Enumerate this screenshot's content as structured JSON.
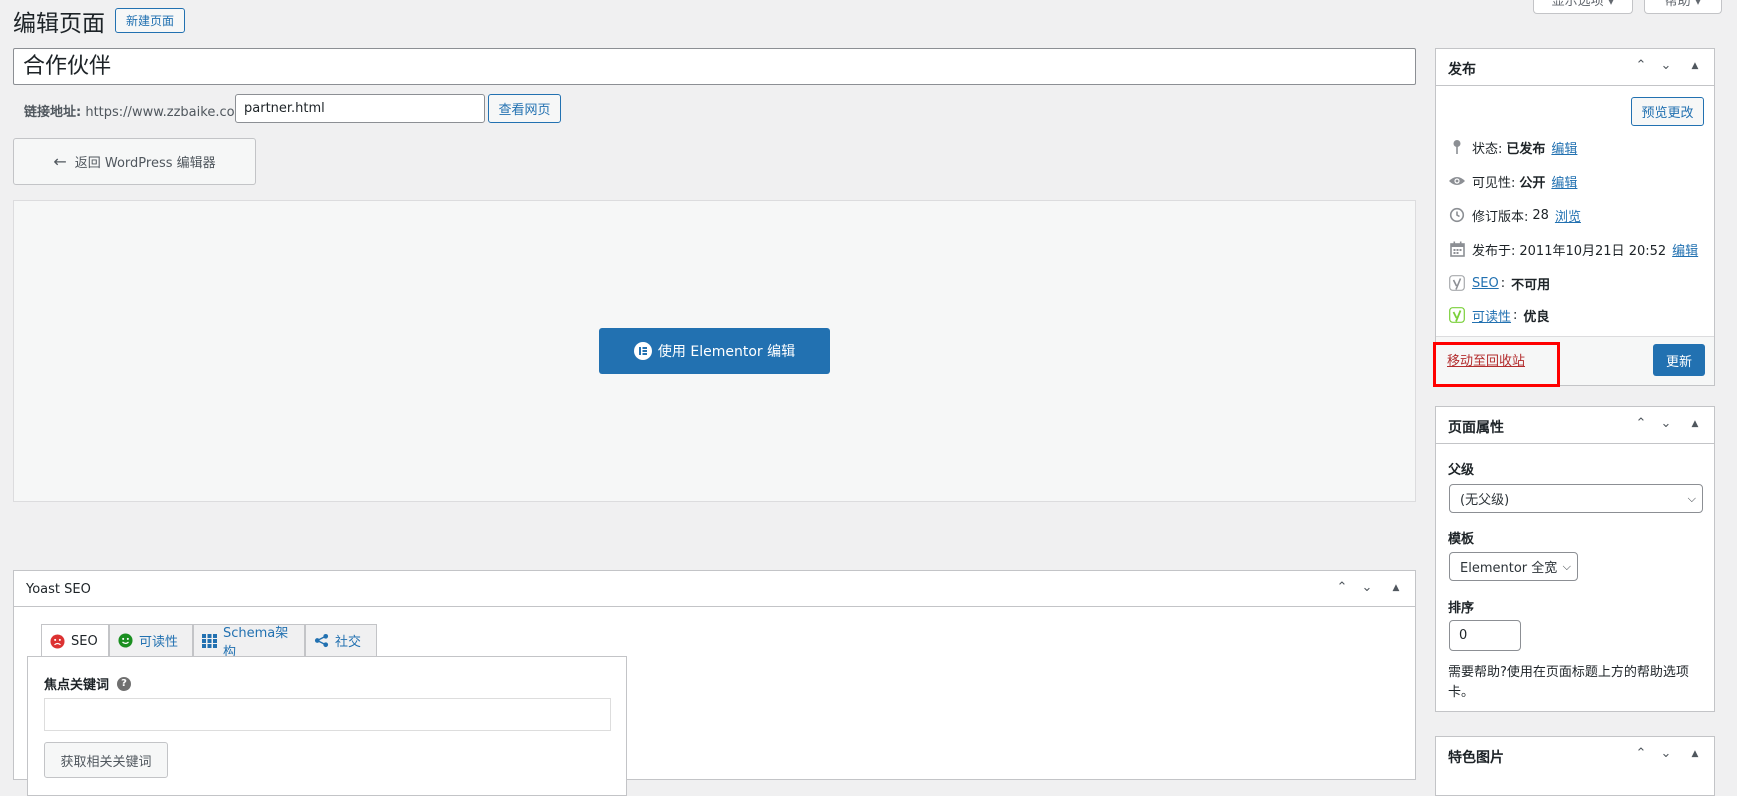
{
  "header": {
    "title": "编辑页面",
    "add_new": "新建页面",
    "screen_options": "显示选项 ▾",
    "help": "帮助 ▾"
  },
  "post": {
    "title": "合作伙伴",
    "permalink_label": "链接地址:",
    "permalink_base": "https://www.zzbaike.com/",
    "slug": "partner.html",
    "view_page": "查看网页"
  },
  "editor": {
    "back_button": "返回 WordPress 编辑器",
    "elementor_button": "使用 Elementor 编辑"
  },
  "publish": {
    "title": "发布",
    "preview": "预览更改",
    "status_label": "状态:",
    "status_value": "已发布",
    "status_edit": "编辑",
    "visibility_label": "可见性:",
    "visibility_value": "公开",
    "visibility_edit": "编辑",
    "revisions_label": "修订版本:",
    "revisions_value": "28",
    "revisions_browse": "浏览",
    "published_label": "发布于:",
    "published_value": "2011年10月21日 20:52",
    "published_edit": "编辑",
    "seo_link": "SEO",
    "seo_value": "不可用",
    "readability_link": "可读性",
    "readability_value": "优良",
    "trash": "移动至回收站",
    "update": "更新"
  },
  "page_attributes": {
    "title": "页面属性",
    "parent_label": "父级",
    "parent_value": "(无父级)",
    "template_label": "模板",
    "template_value": "Elementor 全宽",
    "order_label": "排序",
    "order_value": "0",
    "help_text": "需要帮助?使用在页面标题上方的帮助选项卡。"
  },
  "featured_image": {
    "title": "特色图片"
  },
  "yoast": {
    "title": "Yoast SEO",
    "tabs": [
      {
        "label": "SEO"
      },
      {
        "label": "可读性"
      },
      {
        "label": "Schema架构"
      },
      {
        "label": "社交"
      }
    ],
    "focus_keyword_label": "焦点关键词",
    "focus_keyword_value": "",
    "related_button": "获取相关关键词"
  },
  "colors": {
    "primary": "#2271b1",
    "highlight": "#ff0000",
    "trash": "#b32d2e",
    "seo_bad": "#dc3232",
    "seo_good": "#7ad03a"
  }
}
